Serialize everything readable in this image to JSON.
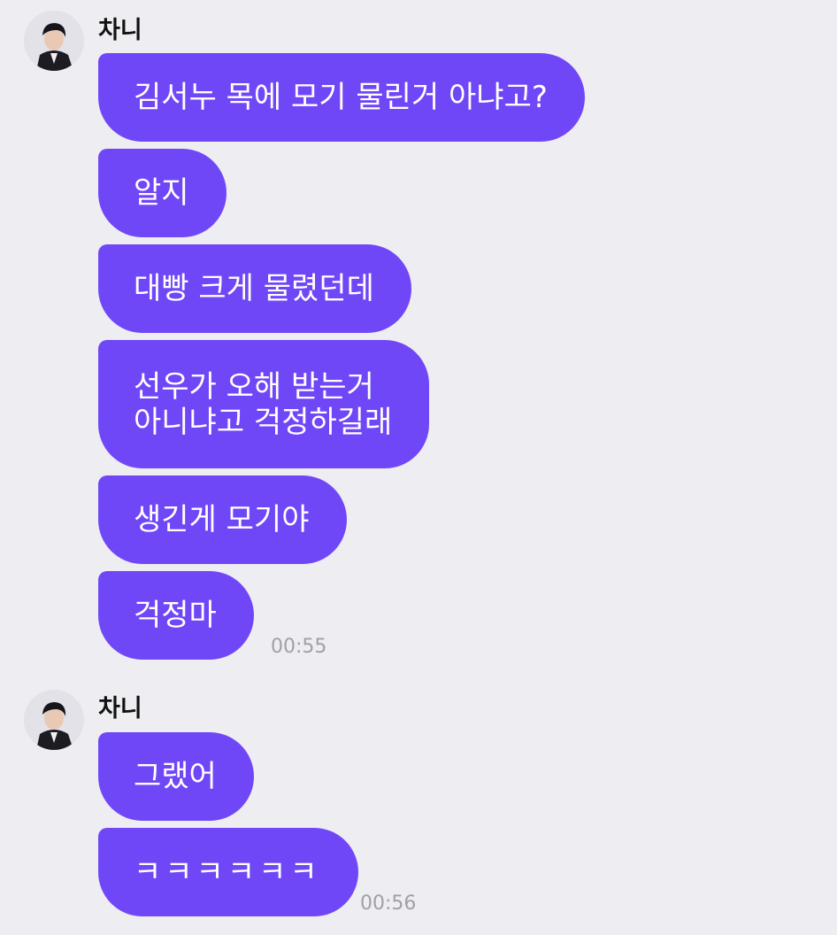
{
  "groups": [
    {
      "sender": "차니",
      "messages": [
        {
          "text": "김서누 목에 모기 물린거 아냐고?"
        },
        {
          "text": "알지"
        },
        {
          "text": "대빵 크게 물렸던데"
        },
        {
          "line1": "선우가 오해 받는거",
          "line2": "아니냐고 걱정하길래"
        },
        {
          "text": "생긴게 모기야"
        },
        {
          "text": "걱정마"
        }
      ],
      "time": "00:55"
    },
    {
      "sender": "차니",
      "messages": [
        {
          "text": "그랬어"
        },
        {
          "text": "ㅋㅋㅋㅋㅋㅋ"
        }
      ],
      "time": "00:56"
    }
  ],
  "colors": {
    "background": "#ededf2",
    "bubble": "#7047f7",
    "bubble_text": "#ffffff",
    "timestamp": "#a0a0a8"
  },
  "icons": {
    "avatar": "profile-photo"
  }
}
